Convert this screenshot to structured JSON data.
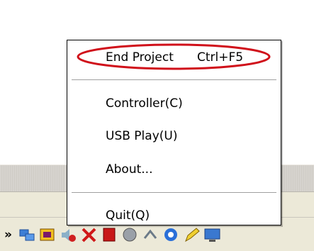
{
  "menu": {
    "end_project": {
      "label": "End Project",
      "shortcut": "Ctrl+F5"
    },
    "controller": {
      "label": "Controller(C)"
    },
    "usb_play": {
      "label": "USB Play(U)"
    },
    "about": {
      "label": "About..."
    },
    "quit": {
      "label": "Quit(Q)"
    },
    "highlight_color": "#d0101a"
  },
  "taskbar": {
    "overflow_label": "»",
    "tray_icons": [
      "network-icon",
      "app-icon",
      "speaker-muted-icon",
      "error-x-icon",
      "red-app-icon",
      "gray-app-icon",
      "connection-icon",
      "blue-circle-icon",
      "pencil-icon",
      "monitor-icon"
    ]
  }
}
